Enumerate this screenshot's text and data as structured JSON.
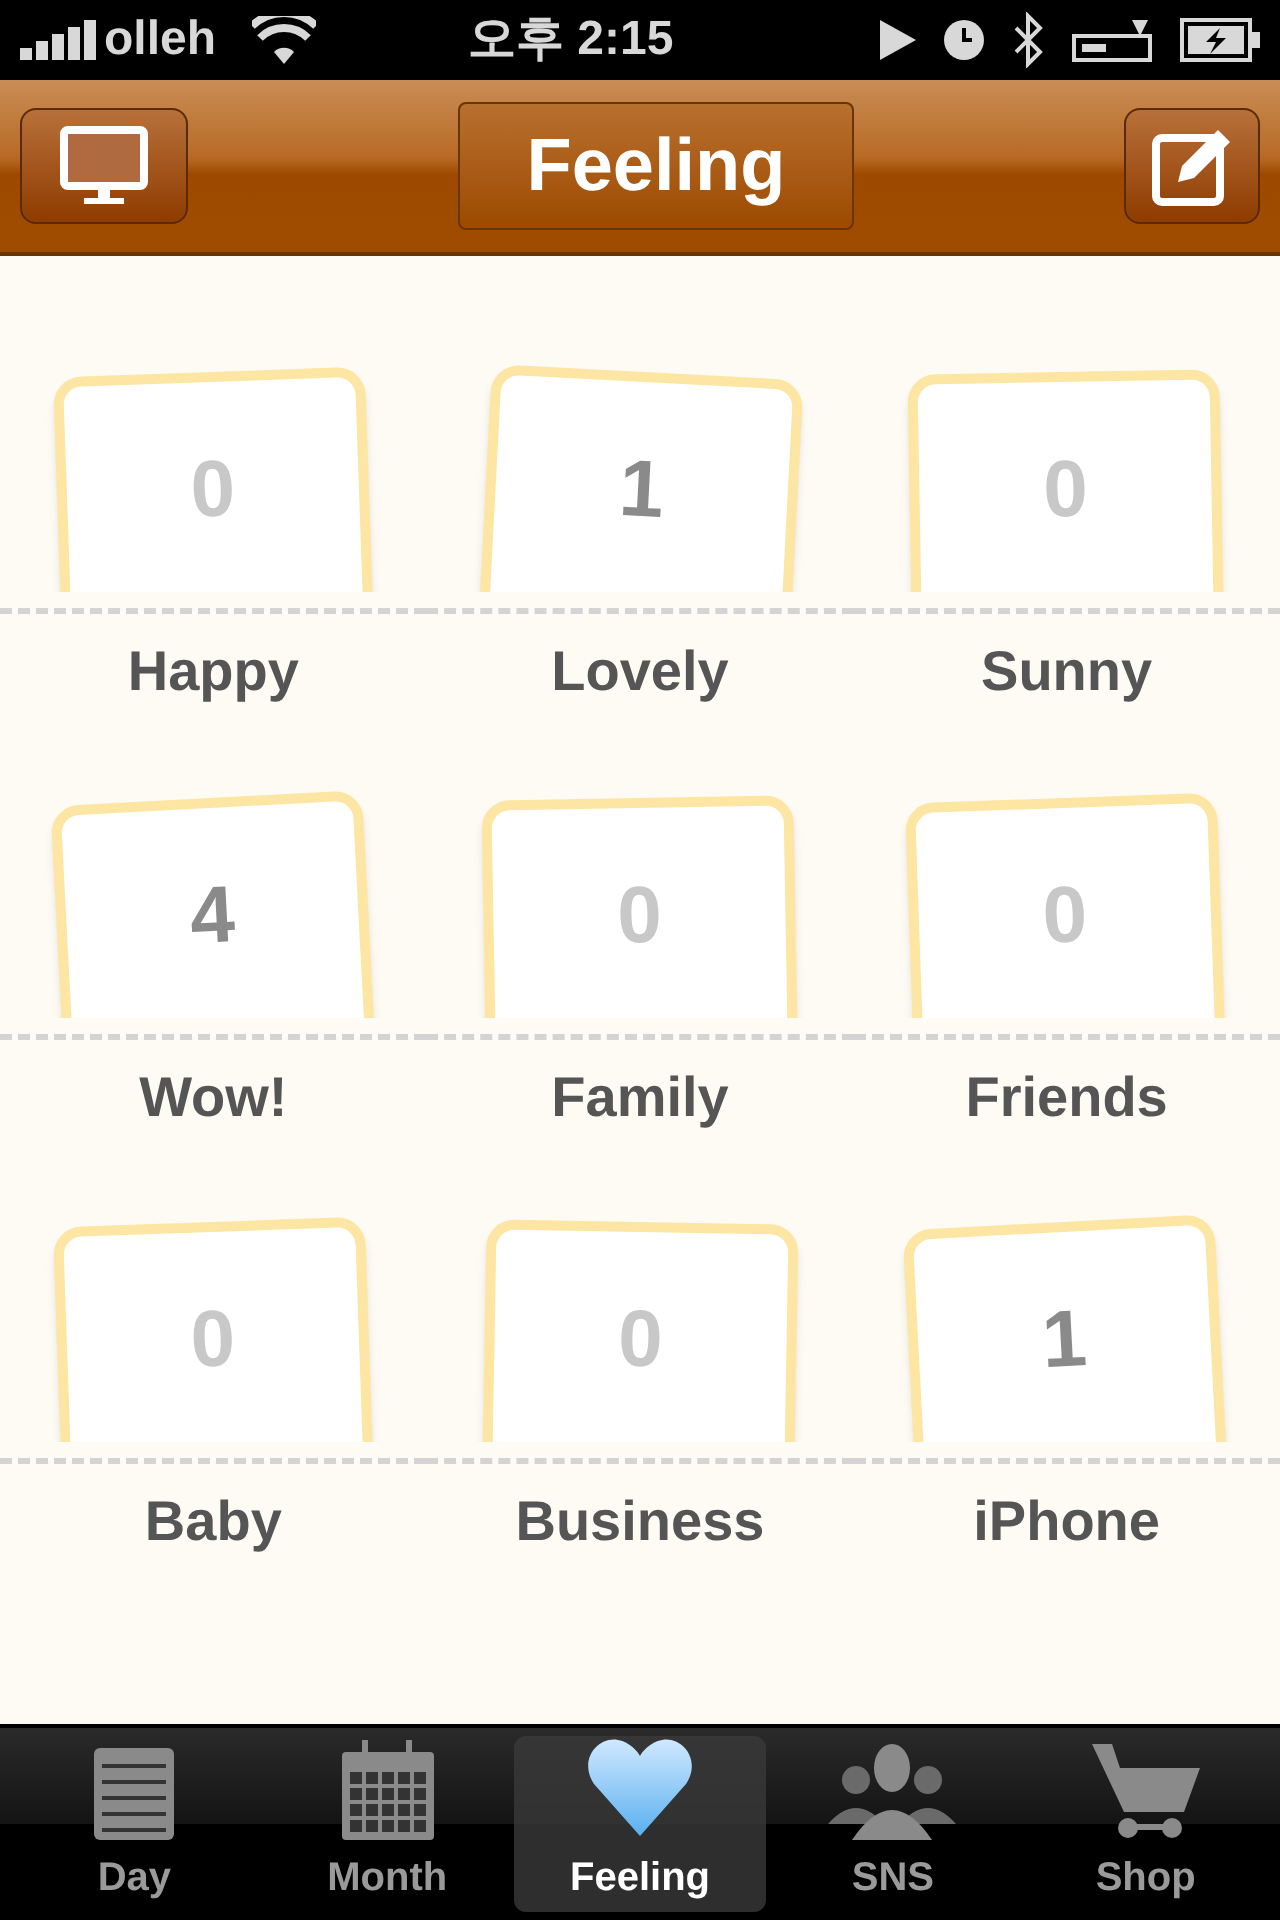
{
  "status_bar": {
    "carrier": "olleh",
    "time": "오후 2:15"
  },
  "nav_bar": {
    "title": "Feeling"
  },
  "feelings": [
    {
      "label": "Happy",
      "count": "0",
      "empty": true
    },
    {
      "label": "Lovely",
      "count": "1",
      "empty": false
    },
    {
      "label": "Sunny",
      "count": "0",
      "empty": true
    },
    {
      "label": "Wow!",
      "count": "4",
      "empty": false
    },
    {
      "label": "Family",
      "count": "0",
      "empty": true
    },
    {
      "label": "Friends",
      "count": "0",
      "empty": true
    },
    {
      "label": "Baby",
      "count": "0",
      "empty": true
    },
    {
      "label": "Business",
      "count": "0",
      "empty": true
    },
    {
      "label": "iPhone",
      "count": "1",
      "empty": false
    }
  ],
  "tab_bar": [
    {
      "label": "Day",
      "kind": "day",
      "selected": false
    },
    {
      "label": "Month",
      "kind": "month",
      "selected": false
    },
    {
      "label": "Feeling",
      "kind": "feeling",
      "selected": true
    },
    {
      "label": "SNS",
      "kind": "sns",
      "selected": false
    },
    {
      "label": "Shop",
      "kind": "shop",
      "selected": false
    }
  ]
}
